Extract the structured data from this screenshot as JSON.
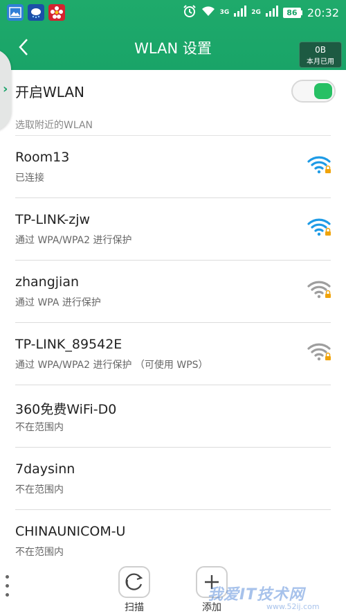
{
  "status_bar": {
    "app_icons": [
      "gallery-icon",
      "weather-icon",
      "flower-app-icon"
    ],
    "alarm_icon": "alarm-icon",
    "network1": "3G",
    "network2": "2G",
    "battery": "86",
    "time": "20:32"
  },
  "header": {
    "title": "WLAN 设置",
    "data_usage_value": "0B",
    "data_usage_label": "本月已用"
  },
  "wlan_toggle": {
    "label": "开启WLAN",
    "on": true
  },
  "section_title": "选取附近的WLAN",
  "networks": [
    {
      "name": "Room13",
      "status": "已连接",
      "signal": "strong",
      "secured": true
    },
    {
      "name": "TP-LINK-zjw",
      "status": "通过 WPA/WPA2 进行保护",
      "signal": "strong",
      "secured": true
    },
    {
      "name": "zhangjian",
      "status": "通过 WPA 进行保护",
      "signal": "weak",
      "secured": true
    },
    {
      "name": "TP-LINK_89542E",
      "status": "通过 WPA/WPA2 进行保护 （可使用 WPS）",
      "signal": "weak",
      "secured": true
    },
    {
      "name": "360免费WiFi-D0",
      "status": "不在范围内"
    },
    {
      "name": "7daysinn",
      "status": "不在范围内"
    },
    {
      "name": "CHINAUNICOM-U",
      "status": "不在范围内"
    }
  ],
  "bottom": {
    "scan_label": "扫描",
    "add_label": "添加"
  },
  "watermark": {
    "text": "我爱IT技术网",
    "sub": "www.52ij.com"
  },
  "colors": {
    "header_green": "#19a468",
    "toggle_on": "#27c064",
    "wifi_strong": "#1e9be6",
    "wifi_weak": "#9e9e9e",
    "lock": "#f0a30a"
  }
}
